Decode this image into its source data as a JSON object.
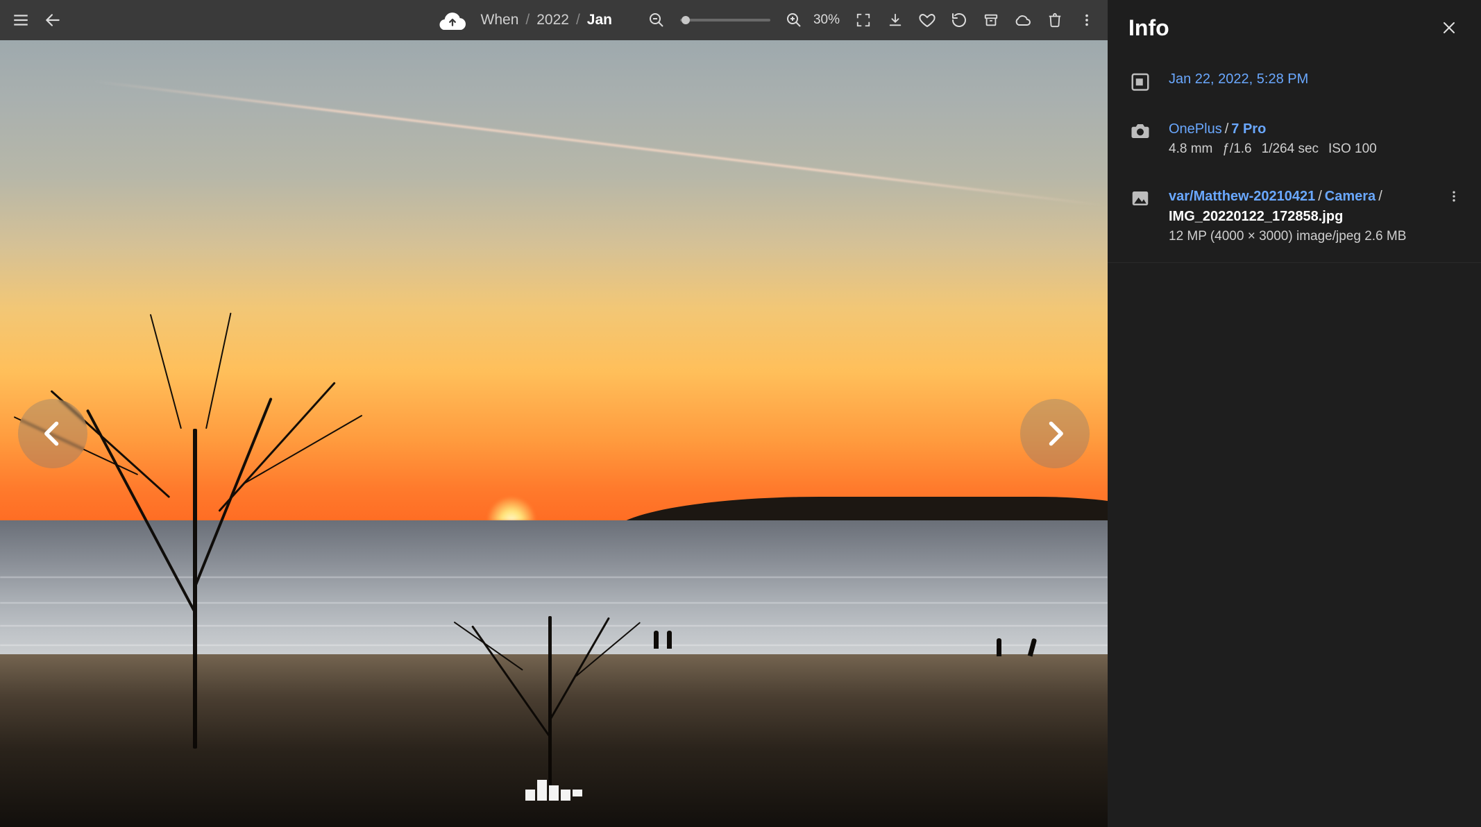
{
  "toolbar": {
    "zoom_label": "30%",
    "breadcrumbs": {
      "root": "When",
      "year": "2022",
      "month": "Jan"
    }
  },
  "info": {
    "title": "Info",
    "date": "Jan 22, 2022, 5:28 PM",
    "camera": {
      "make": "OnePlus",
      "model": "7 Pro",
      "focal": "4.8 mm",
      "aperture": "ƒ/1.6",
      "shutter": "1/264 sec",
      "iso": "ISO 100"
    },
    "file": {
      "path_seg1": "var/Matthew-20210421",
      "path_seg2": "Camera",
      "name": "IMG_20220122_172858.jpg",
      "details": "12 MP (4000 × 3000) image/jpeg 2.6 MB"
    }
  }
}
